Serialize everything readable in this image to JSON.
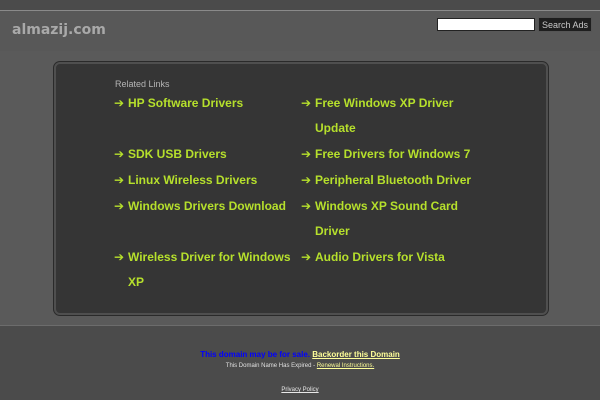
{
  "header": {
    "site_title": "almazij.com",
    "search_placeholder": "",
    "search_button": "Search Ads"
  },
  "related": {
    "title": "Related Links",
    "arrow": "➔",
    "left_links": [
      "HP Software Drivers",
      "SDK USB Drivers",
      "Linux Wireless Drivers",
      "Windows Drivers Download",
      "Wireless Driver for Windows XP"
    ],
    "right_links": [
      "Free Windows XP Driver Update",
      "Free Drivers for Windows 7",
      "Peripheral Bluetooth Driver",
      "Windows XP Sound Card Driver",
      "Audio Drivers for Vista"
    ]
  },
  "footer": {
    "sale_text": "This domain may be for sale.",
    "backorder_link": "Backorder this Domain",
    "expired_text": "This Domain Name Has Expired -",
    "renewal_link": "Renewal Instructions.",
    "privacy_link": "Privacy Policy"
  },
  "colors": {
    "background": "#4b4b4b",
    "panel": "#353535",
    "link": "#b6e02c",
    "sale_text": "#0000ff",
    "footer_link": "#ffff99"
  }
}
